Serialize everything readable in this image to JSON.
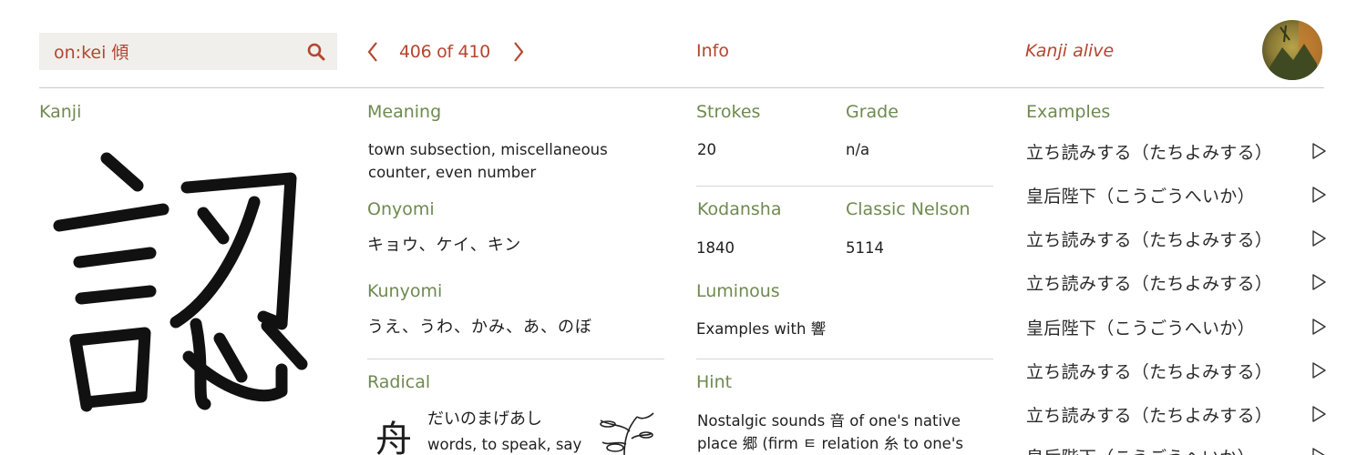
{
  "search": {
    "value": "on:kei 傾"
  },
  "pager": {
    "count": "406 of 410"
  },
  "tabs": {
    "info": "Info",
    "brand": "Kanji alive"
  },
  "kanji_col": {
    "heading": "Kanji"
  },
  "meaning": {
    "heading": "Meaning",
    "line1": "town subsection, miscellaneous",
    "line2": "counter, even number"
  },
  "onyomi": {
    "heading": "Onyomi",
    "value": "キョウ、ケイ、キン"
  },
  "kunyomi": {
    "heading": "Kunyomi",
    "value": "うえ、うわ、かみ、あ、のぼ"
  },
  "radical": {
    "heading": "Radical",
    "char": "舟",
    "reading": "だいのまげあし",
    "meaning": "words, to speak, say"
  },
  "strokes": {
    "heading": "Strokes",
    "value": "20"
  },
  "grade": {
    "heading": "Grade",
    "value": "n/a"
  },
  "kodansha": {
    "heading": "Kodansha",
    "value": "1840"
  },
  "classic_nelson": {
    "heading": "Classic Nelson",
    "value": "5114"
  },
  "luminous": {
    "heading": "Luminous",
    "value": "Examples with 響"
  },
  "hint": {
    "heading": "Hint",
    "line1": "Nostalgic sounds 音 of one's native",
    "line2": "place 郷 (firm ㅌ relation 糸 to one's"
  },
  "examples": {
    "heading": "Examples",
    "items": [
      "立ち読みする（たちよみする）",
      "皇后陛下（こうごうへいか）",
      "立ち読みする（たちよみする）",
      "立ち読みする（たちよみする）",
      "皇后陛下（こうごうへいか）",
      "立ち読みする（たちよみする）",
      "立ち読みする（たちよみする）",
      "皇后陛下（こうごうへいか）"
    ]
  },
  "colors": {
    "accent": "#b5452f",
    "label_green": "#6e8a50",
    "search_bg": "#f1efec"
  },
  "icons": {
    "search": "search-icon",
    "prev": "chevron-left-icon",
    "next": "chevron-right-icon",
    "play": "play-icon"
  }
}
